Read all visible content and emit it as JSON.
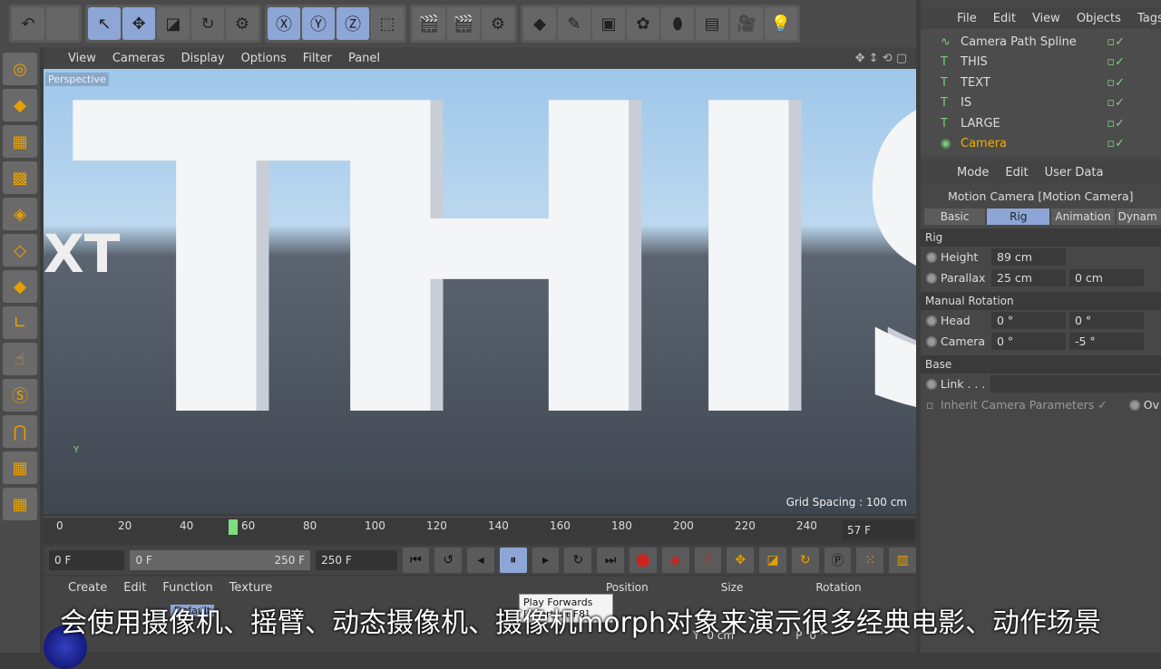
{
  "viewport": {
    "menu": [
      "View",
      "Cameras",
      "Display",
      "Options",
      "Filter",
      "Panel"
    ],
    "label": "Perspective",
    "grid": "Grid Spacing : 100 cm",
    "letters": [
      "T",
      "H",
      "I",
      "S"
    ],
    "bg_text": "XT",
    "axis_y": "Y"
  },
  "timeline": {
    "ticks": [
      "0",
      "20",
      "40",
      "60",
      "80",
      "100",
      "120",
      "140",
      "160",
      "180",
      "200",
      "220",
      "240"
    ],
    "current_frame": 57,
    "frame_display": "57 F",
    "max": 250
  },
  "controls": {
    "start": "0 F",
    "range_start": "0 F",
    "range_end": "250 F",
    "end": "250 F"
  },
  "tooltip": {
    "title": "Play Forwards",
    "shortcut": "[Shortcut F8]"
  },
  "material": {
    "menu": [
      "Create",
      "Edit",
      "Function",
      "Texture"
    ],
    "tag": "Default"
  },
  "coords": {
    "headers": [
      "Position",
      "Size",
      "Rotation"
    ],
    "y_label": "Y",
    "y_size": "0 cm",
    "p_label": "P",
    "p_val": "0 °"
  },
  "objects": {
    "menu": [
      "File",
      "Edit",
      "View",
      "Objects",
      "Tags"
    ],
    "items": [
      {
        "name": "Camera Path Spline",
        "icon": "spline-icon"
      },
      {
        "name": "THIS",
        "icon": "text-icon"
      },
      {
        "name": "TEXT",
        "icon": "text-icon"
      },
      {
        "name": "IS",
        "icon": "text-icon"
      },
      {
        "name": "LARGE",
        "icon": "text-icon"
      },
      {
        "name": "Camera",
        "icon": "camera-icon",
        "selected": true
      }
    ]
  },
  "attributes": {
    "menu": [
      "Mode",
      "Edit",
      "User Data"
    ],
    "title": "Motion Camera [Motion Camera]",
    "tabs": [
      "Basic",
      "Rig",
      "Animation",
      "Dynam"
    ],
    "active_tab": "Rig",
    "sections": {
      "rig": "Rig",
      "manual": "Manual Rotation",
      "base": "Base"
    },
    "height": {
      "label": "Height",
      "value": "89 cm"
    },
    "parallax": {
      "label": "Parallax",
      "v1": "25 cm",
      "v2": "0 cm"
    },
    "head": {
      "label": "Head",
      "v1": "0 °",
      "v2": "0 °"
    },
    "camera": {
      "label": "Camera",
      "v1": "0 °",
      "v2": "-5 °"
    },
    "link": {
      "label": "Link . . ."
    },
    "inherit": "Inherit Camera Parameters",
    "ov": "Ov"
  },
  "subtitle": "会使用摄像机、摇臂、动态摄像机、摄像机morph对象来演示很多经典电影、动作场景",
  "colors": {
    "accent": "#8da6d6",
    "selected_object": "#f0b000",
    "playhead": "#7fdc7f"
  }
}
